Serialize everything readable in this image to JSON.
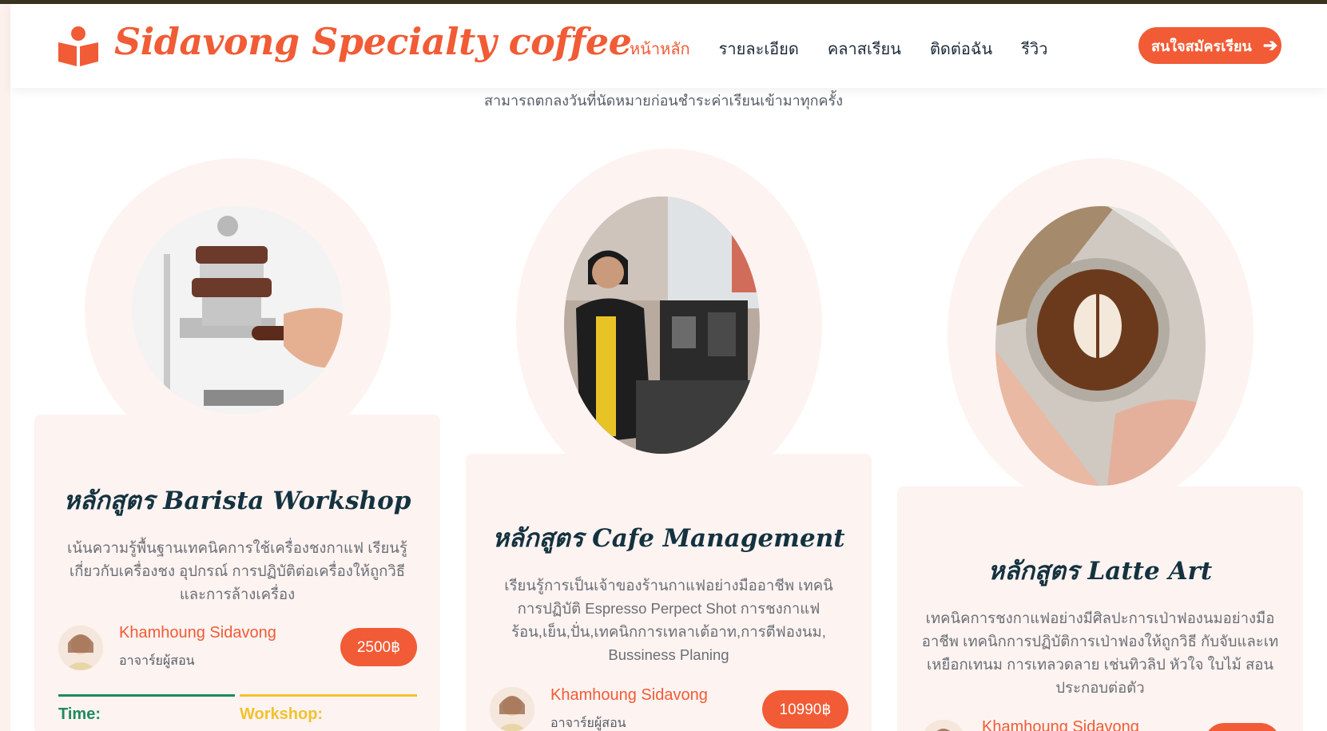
{
  "header": {
    "brand": "Sidavong Specialty coffee",
    "nav": [
      "หน้าหลัก",
      "รายละเอียด",
      "คลาสเรียน",
      "ติดต่อฉัน",
      "รีวิว"
    ],
    "cta_label": "สนใจสมัครเรียน",
    "accent_color": "#f15b35"
  },
  "section": {
    "subtitle": "สามารถตกลงวันที่นัดหมายก่อนชำระค่าเรียนเข้ามาทุกครั้ง"
  },
  "courses": [
    {
      "title": "หลักสูตร Barista Workshop",
      "desc": "เน้นความรู้พื้นฐานเทคนิคการใช้เครื่องชงกาแฟ เรียนรู้เกี่ยวกับเครื่องชง อุปกรณ์ การปฏิบัติต่อเครื่องให้ถูกวิธีและการล้างเครื่อง",
      "teacher": "Khamhoung Sidavong",
      "role": "อาจาร์ยผู้สอน",
      "price": "2500฿",
      "meta": [
        "Time:",
        "Workshop:"
      ]
    },
    {
      "title": "หลักสูตร Cafe Management",
      "desc": "เรียนรู้การเป็นเจ้าของร้านกาแฟอย่างมืออาชีพ เทคนิการปฏิบัติ Espresso Perpect Shot การชงกาแฟร้อน,เย็น,ปั่น,เทคนิกการเทลาเต้อาท,การตีฟองนม, Bussiness Planing",
      "teacher": "Khamhoung Sidavong",
      "role": "อาจาร์ยผู้สอน",
      "price": "10990฿"
    },
    {
      "title": "หลักสูตร Latte Art",
      "desc": "เทคนิคการชงกาแฟอย่างมีศิลปะการเป่าฟองนมอย่างมืออาชีพ เทคนิกการปฏิบัติการเป่าฟองให้ถูกวิธี กับจับและเทเหยือกเทนม การเทลวดลาย เช่นทิวลิป หัวใจ ใบไม้ สอนประกอบต่อตัว",
      "teacher": "Khamhoung Sidavong"
    }
  ]
}
